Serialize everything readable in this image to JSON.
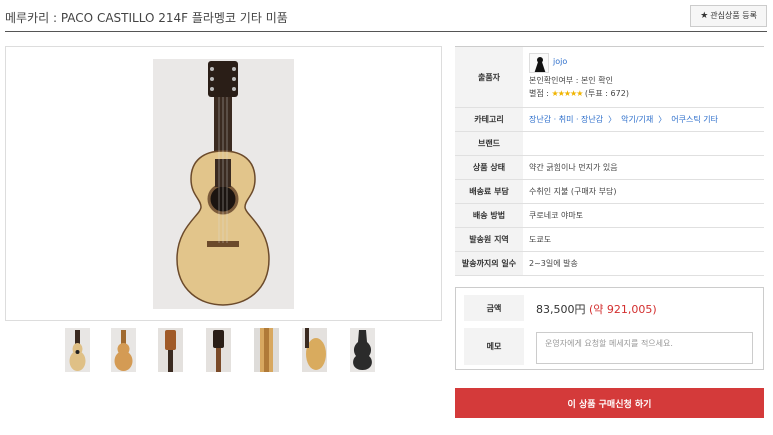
{
  "header": {
    "title": "메루카리 : PACO CASTILLO 214F 플라멩코 기타 미품",
    "fav_button": "관심상품 등록",
    "fav_icon": "star-icon"
  },
  "thumbnails": [
    "guitar-front-full",
    "guitar-back",
    "guitar-headstock",
    "guitar-headstock-back",
    "guitar-side",
    "guitar-side-body",
    "guitar-case"
  ],
  "info": {
    "seller_label": "출품자",
    "seller_name": "jojo",
    "seller_verify": "본인확인여부 : 본인 확인",
    "seller_rating_label": "별점 :",
    "seller_stars": "★★★★★",
    "seller_votes": "(투표 : 672)",
    "category_label": "카테고리",
    "category_path": [
      "장난감 · 취미 · 장난감",
      "악기/기재",
      "어쿠스틱 기타"
    ],
    "category_sep": "〉",
    "brand_label": "브랜드",
    "brand_value": "",
    "condition_label": "상품 상태",
    "condition_value": "약간 긁힘이나 먼지가 있음",
    "shipping_fee_label": "배송료 부담",
    "shipping_fee_value": "수취인 지불 (구매자 부담)",
    "shipping_method_label": "배송 방법",
    "shipping_method_value": "쿠로네코 야마토",
    "origin_label": "발송원 지역",
    "origin_value": "도쿄도",
    "days_label": "발송까지의 일수",
    "days_value": "2~3일에 발송"
  },
  "order": {
    "amount_label": "금액",
    "price_jpy": "83,500円",
    "price_krw": "(약 921,005)",
    "memo_label": "메모",
    "memo_placeholder": "운영자에게 요청할 메세지를 적으세요."
  },
  "buy_button": "이 상품 구매신청 하기",
  "colors": {
    "accent": "#d43a3a",
    "link": "#2c6ecb",
    "star": "#f0b400",
    "label_bg": "#f3f3f3"
  }
}
